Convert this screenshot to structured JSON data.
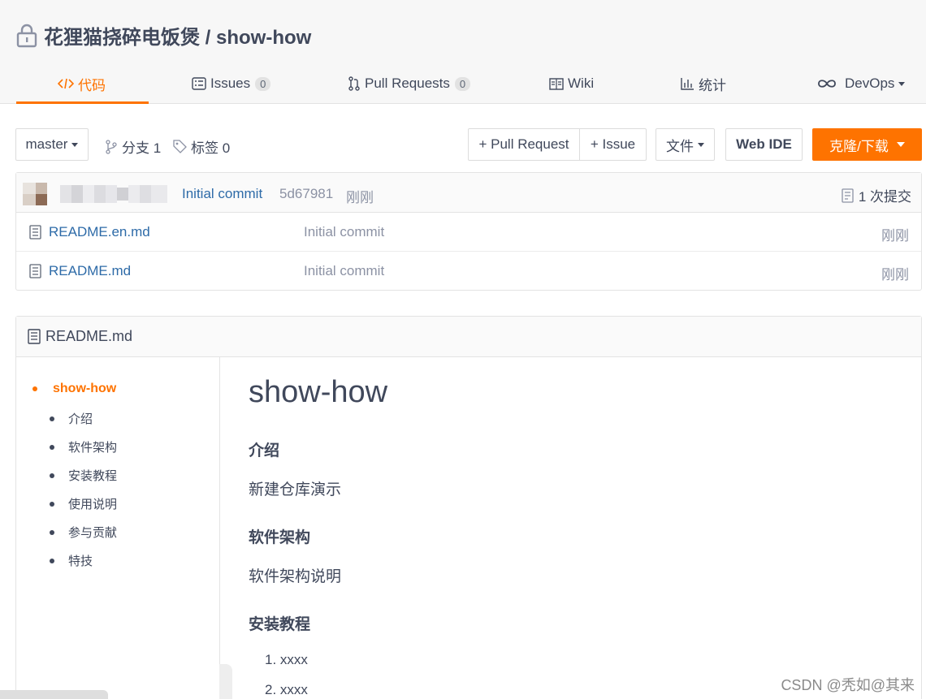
{
  "repo": {
    "title": "花狸猫挠碎电饭煲 / show-how"
  },
  "tabs": [
    {
      "label": "代码",
      "icon": "code-icon"
    },
    {
      "label": "Issues",
      "icon": "issues-icon",
      "count": "0"
    },
    {
      "label": "Pull Requests",
      "icon": "pull-request-icon",
      "count": "0"
    },
    {
      "label": "Wiki",
      "icon": "wiki-book-icon"
    },
    {
      "label": "统计",
      "icon": "stats-chart-icon"
    },
    {
      "label": "DevOps",
      "icon": "infinity-icon"
    }
  ],
  "toolbar": {
    "branch": "master",
    "branches_label": "分支 1",
    "tags_label": "标签 0",
    "new_pr": "+ Pull Request",
    "new_issue": "+ Issue",
    "file_menu": "文件",
    "web_ide": "Web IDE",
    "clone": "克隆/下载"
  },
  "commit": {
    "message": "Initial commit",
    "sha": "5d67981",
    "time": "刚刚",
    "count_label": "1 次提交"
  },
  "files": [
    {
      "name": "README.en.md",
      "message": "Initial commit",
      "time": "刚刚"
    },
    {
      "name": "README.md",
      "message": "Initial commit",
      "time": "刚刚"
    }
  ],
  "readme": {
    "filename": "README.md",
    "toc": {
      "main": "show-how",
      "items": [
        "介绍",
        "软件架构",
        "安装教程",
        "使用说明",
        "参与贡献",
        "特技"
      ]
    },
    "content": {
      "h1": "show-how",
      "s1_title": "介绍",
      "s1_text": "新建仓库演示",
      "s2_title": "软件架构",
      "s2_text": "软件架构说明",
      "s3_title": "安装教程",
      "list": [
        "1. xxxx",
        "2. xxxx"
      ]
    }
  },
  "watermark": "CSDN @秃如@其来",
  "colors": {
    "accent": "#fe7300",
    "link": "#2e6ba8",
    "muted": "#8c92a4",
    "text": "#40485b"
  }
}
